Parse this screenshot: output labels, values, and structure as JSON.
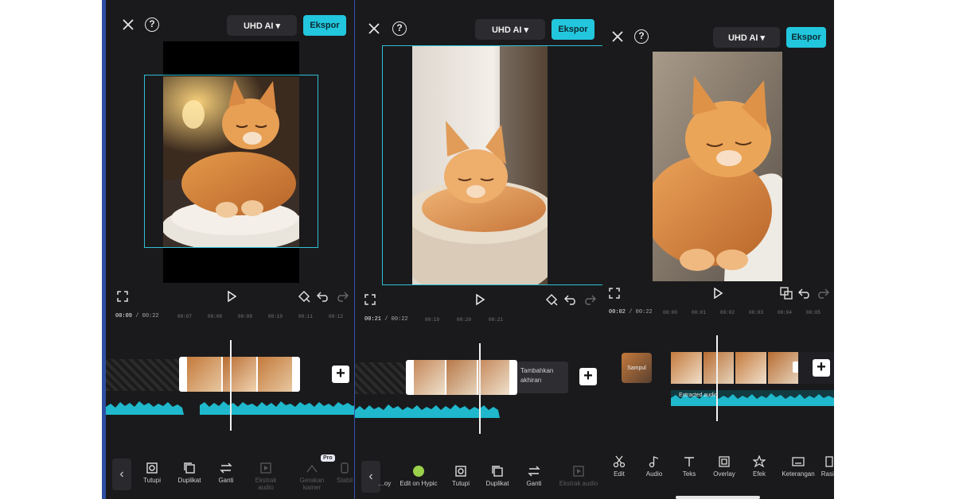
{
  "panels": [
    {
      "header": {
        "uhd_label": "UHD AI ▾",
        "export_label": "Ekspor"
      },
      "timeline": {
        "current": "00:09",
        "total": "00:22",
        "ticks": [
          "00:07",
          "00:08",
          "00:09",
          "00:10",
          "00:11",
          "00:12"
        ]
      },
      "toolbar": [
        {
          "label": "Tutupi",
          "icon": "mask-icon",
          "enabled": true
        },
        {
          "label": "Duplikat",
          "icon": "duplicate-icon",
          "enabled": true
        },
        {
          "label": "Ganti",
          "icon": "replace-icon",
          "enabled": true
        },
        {
          "label": "Ekstrak audio",
          "icon": "extract-audio-icon",
          "enabled": false
        },
        {
          "label": "Gerakan kamer",
          "icon": "camera-motion-icon",
          "enabled": false
        },
        {
          "label": "Stabil",
          "icon": "stabilize-icon",
          "enabled": false
        }
      ],
      "pro_badge": "Pro"
    },
    {
      "header": {
        "uhd_label": "UHD AI ▾",
        "export_label": "Ekspor"
      },
      "timeline": {
        "current": "00:21",
        "total": "00:22",
        "ticks": [
          "00:19",
          "00:20",
          "00:21"
        ]
      },
      "add_ending_label": "Tambahkan akhiran",
      "toolbar": [
        {
          "label": "…oy",
          "icon": "partial-icon",
          "enabled": true
        },
        {
          "label": "Edit on Hypic",
          "icon": "hypic-icon",
          "enabled": true
        },
        {
          "label": "Tutupi",
          "icon": "mask-icon",
          "enabled": true
        },
        {
          "label": "Duplikat",
          "icon": "duplicate-icon",
          "enabled": true
        },
        {
          "label": "Ganti",
          "icon": "replace-icon",
          "enabled": true
        },
        {
          "label": "Ekstrak audio",
          "icon": "extract-audio-icon",
          "enabled": false
        }
      ]
    },
    {
      "header": {
        "uhd_label": "UHD AI ▾",
        "export_label": "Ekspor"
      },
      "timeline": {
        "current": "00:02",
        "total": "00:22",
        "ticks": [
          "00:00",
          "00:01",
          "00:02",
          "00:03",
          "00:04",
          "00:05"
        ]
      },
      "cover_label": "Sampul",
      "audio_track_label": "Extracted audio",
      "toolbar": [
        {
          "label": "Edit",
          "icon": "scissors-icon",
          "enabled": true
        },
        {
          "label": "Audio",
          "icon": "music-note-icon",
          "enabled": true
        },
        {
          "label": "Teks",
          "icon": "text-icon",
          "enabled": true
        },
        {
          "label": "Overlay",
          "icon": "overlay-icon",
          "enabled": true
        },
        {
          "label": "Efek",
          "icon": "effects-icon",
          "enabled": true
        },
        {
          "label": "Keterangan",
          "icon": "captions-icon",
          "enabled": true
        },
        {
          "label": "Rasio",
          "icon": "ratio-icon",
          "enabled": true
        }
      ]
    }
  ],
  "colors": {
    "accent": "#22c6dd",
    "panel_bg": "#1a1a1c",
    "audio_wave": "#1fb8cc"
  }
}
